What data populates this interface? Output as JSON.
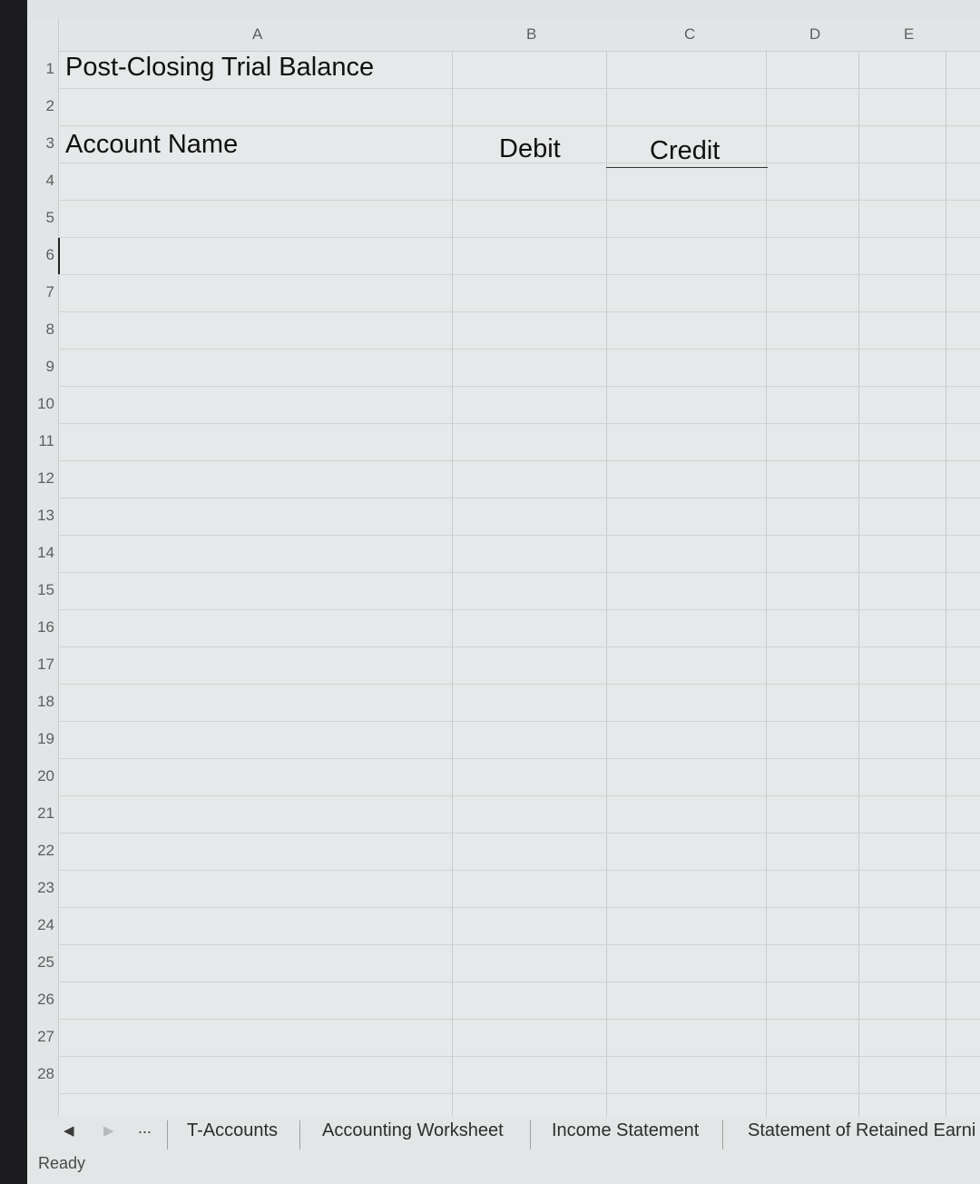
{
  "columns": [
    "A",
    "B",
    "C",
    "D",
    "E"
  ],
  "rows": [
    "1",
    "2",
    "3",
    "4",
    "5",
    "6",
    "7",
    "8",
    "9",
    "10",
    "11",
    "12",
    "13",
    "14",
    "15",
    "16",
    "17",
    "18",
    "19",
    "20",
    "21",
    "22",
    "23",
    "24",
    "25",
    "26",
    "27",
    "28"
  ],
  "cells": {
    "title": "Post-Closing Trial  Balance",
    "account_name_header": "Account Name",
    "debit_header": "Debit",
    "credit_header": "Credit"
  },
  "sheet_tabs": [
    "T-Accounts",
    "Accounting Worksheet",
    "Income Statement",
    "Statement of Retained Earni"
  ],
  "nav": {
    "prev": "◀",
    "next": "▶",
    "more": "..."
  },
  "status": "Ready"
}
